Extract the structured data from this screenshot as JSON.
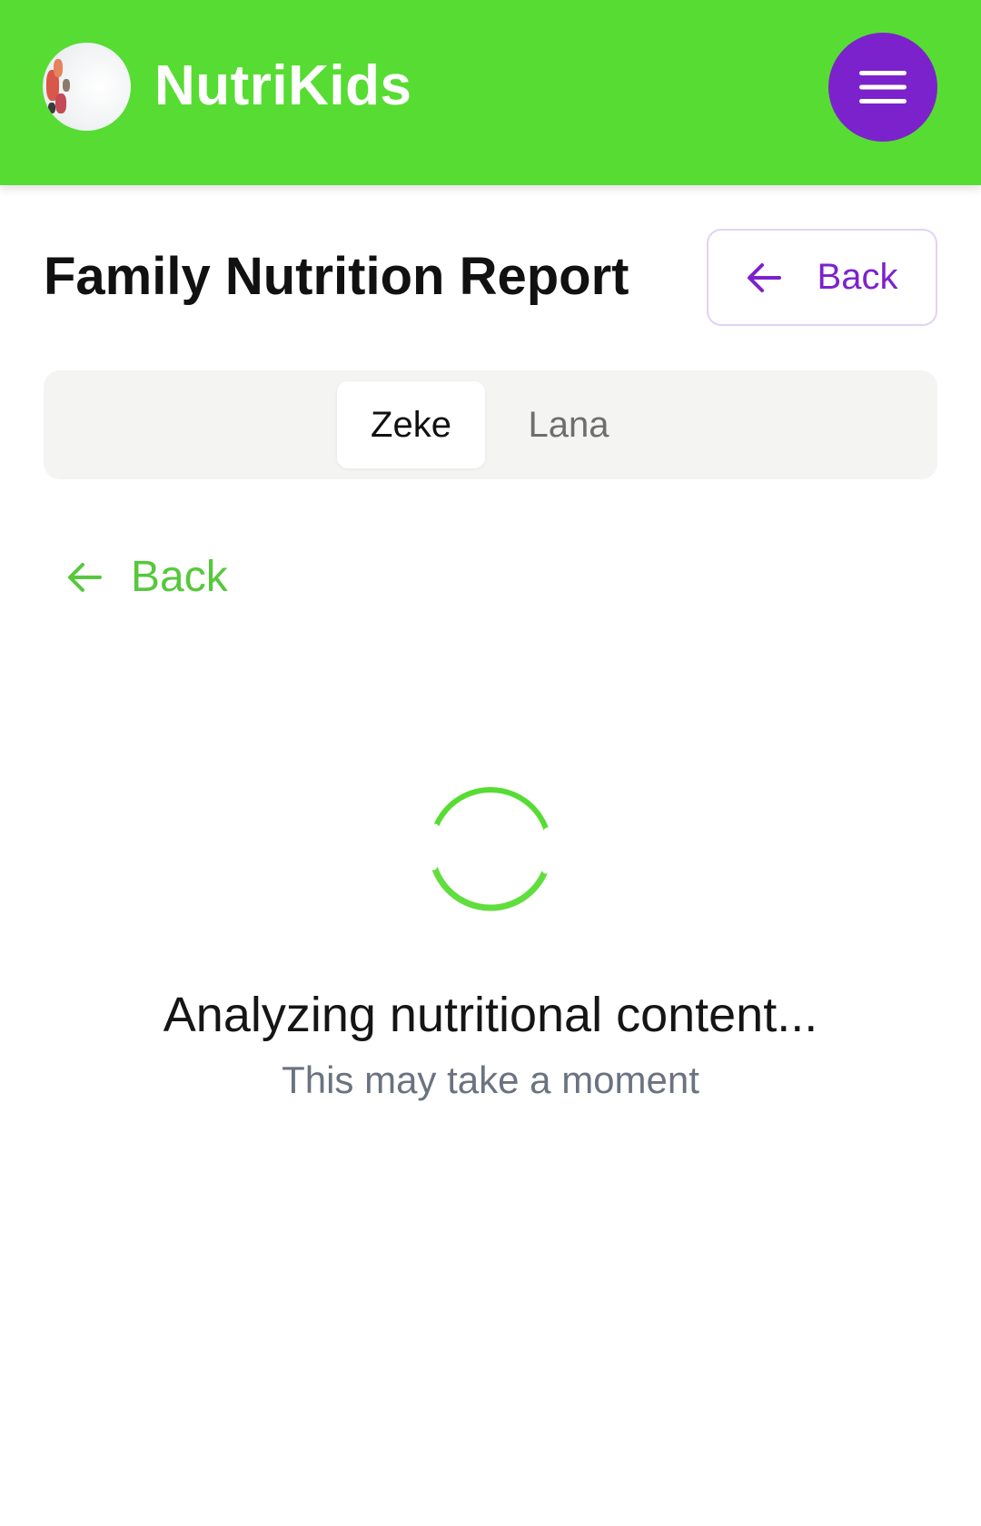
{
  "header": {
    "brand": "NutriKids",
    "avatar_icon": "child-food-avatar",
    "menu_icon": "hamburger-menu-icon",
    "background_color": "#57dc33",
    "menu_color": "#7c22cc"
  },
  "page": {
    "title": "Family Nutrition Report",
    "back_button_label": "Back",
    "back_button_color": "#7c22cc"
  },
  "tabs": [
    {
      "label": "Zeke",
      "selected": true
    },
    {
      "label": "Lana",
      "selected": false
    }
  ],
  "subnav": {
    "back_label": "Back",
    "color": "#57c83c"
  },
  "loading": {
    "title": "Analyzing nutritional content...",
    "subtitle": "This may take a moment",
    "spinner_color": "#57dc33"
  }
}
